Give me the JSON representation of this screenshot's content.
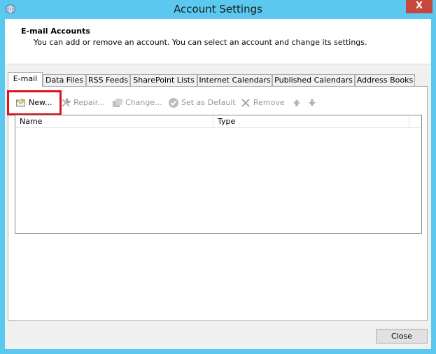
{
  "window": {
    "title": "Account Settings",
    "close_glyph": "X"
  },
  "header": {
    "title": "E-mail Accounts",
    "subtitle": "You can add or remove an account. You can select an account and change its settings."
  },
  "tabs": [
    {
      "label": "E-mail",
      "active": true
    },
    {
      "label": "Data Files"
    },
    {
      "label": "RSS Feeds"
    },
    {
      "label": "SharePoint Lists"
    },
    {
      "label": "Internet Calendars"
    },
    {
      "label": "Published Calendars"
    },
    {
      "label": "Address Books"
    }
  ],
  "toolbar": {
    "new_label": "New...",
    "repair_label": "Repair...",
    "change_label": "Change...",
    "default_label": "Set as Default",
    "remove_label": "Remove"
  },
  "list": {
    "columns": [
      "Name",
      "Type"
    ],
    "rows": []
  },
  "footer": {
    "close_label": "Close"
  },
  "colors": {
    "titlebar": "#5bc8ef",
    "highlight": "#e0101e",
    "close_button": "#c7473f"
  }
}
